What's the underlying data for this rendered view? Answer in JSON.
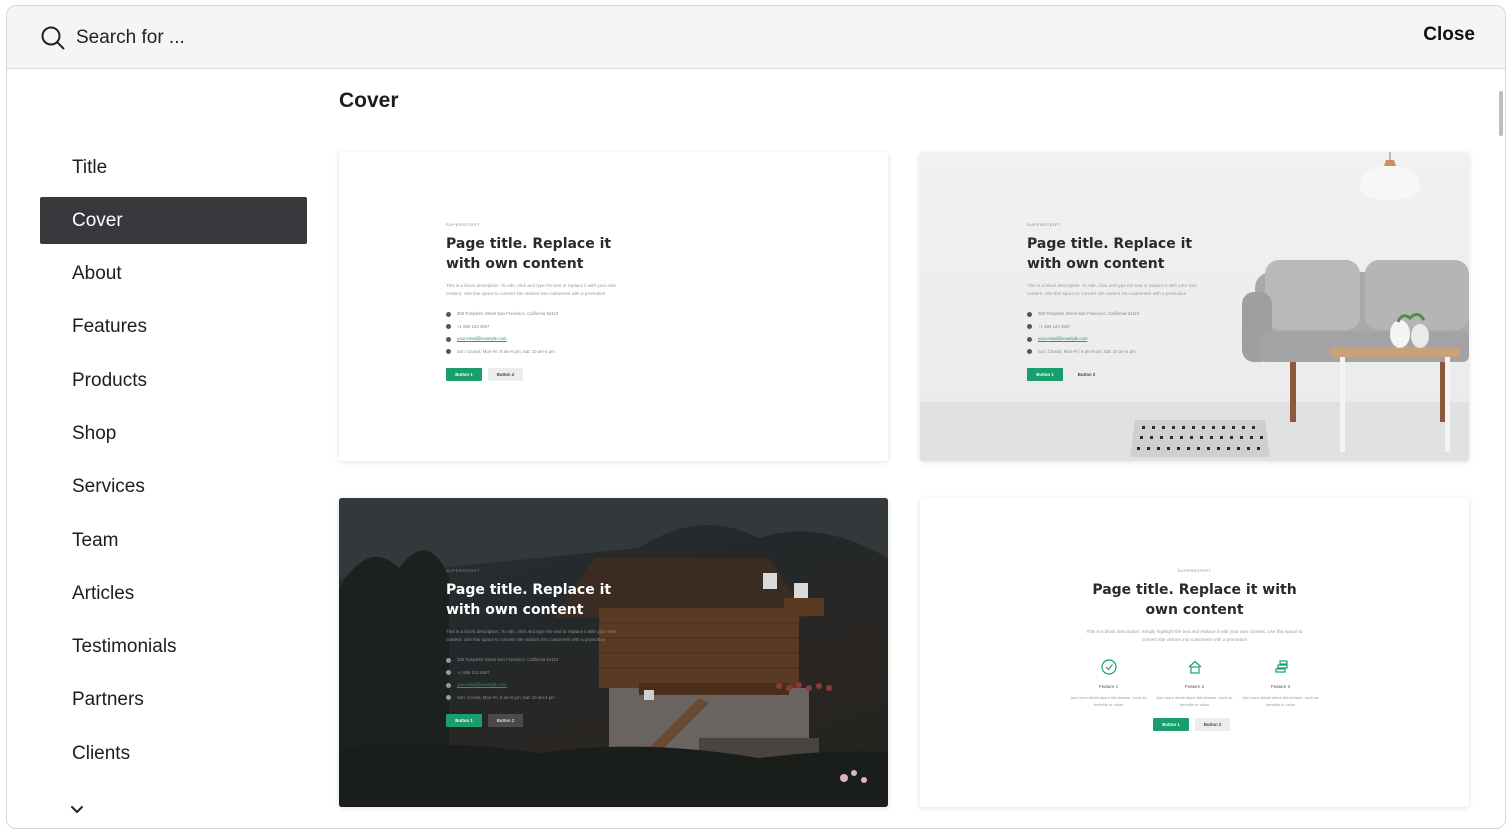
{
  "search": {
    "placeholder": "Search for ..."
  },
  "header": {
    "close_label": "Close"
  },
  "sidebar": {
    "items": [
      {
        "label": "Title"
      },
      {
        "label": "Cover"
      },
      {
        "label": "About"
      },
      {
        "label": "Features"
      },
      {
        "label": "Products"
      },
      {
        "label": "Shop"
      },
      {
        "label": "Services"
      },
      {
        "label": "Team"
      },
      {
        "label": "Articles"
      },
      {
        "label": "Testimonials"
      },
      {
        "label": "Partners"
      },
      {
        "label": "Clients"
      }
    ],
    "active_index": 1
  },
  "main": {
    "section_title": "Cover"
  },
  "template": {
    "superscript": "SUPERSCRIPT",
    "title": "Page title. Replace it with own content",
    "description": "This is a block description. To edit, click and type the text or replace it with your own content. Use this space to convert site visitors into customers with a promotion",
    "address": "355 Tompkins Street San Francisco, California 94110",
    "phone": "+1 888 123 4567",
    "email": "your.email@example.com",
    "hours": "Sun: Closed, Mon-Fri: 8 am-6 pm; Sat: 10 am-4 pm",
    "button1": "Button 1",
    "button2": "Button 2",
    "center_description": "This is a block description. Simply highlight the text and replace it with your own content. Use this space to convert site visitors into customers with a promotion",
    "features": [
      {
        "name": "Feature 1",
        "desc": "Add more detail about this feature, such as benefits or value"
      },
      {
        "name": "Feature 2",
        "desc": "Add more detail about this feature, such as benefits or value"
      },
      {
        "name": "Feature 3",
        "desc": "Add more detail about this feature, such as benefits or value"
      }
    ]
  },
  "colors": {
    "accent_green": "#1a9e6e",
    "active_nav_bg": "#37373c",
    "topbar_bg": "#f5f5f6"
  }
}
